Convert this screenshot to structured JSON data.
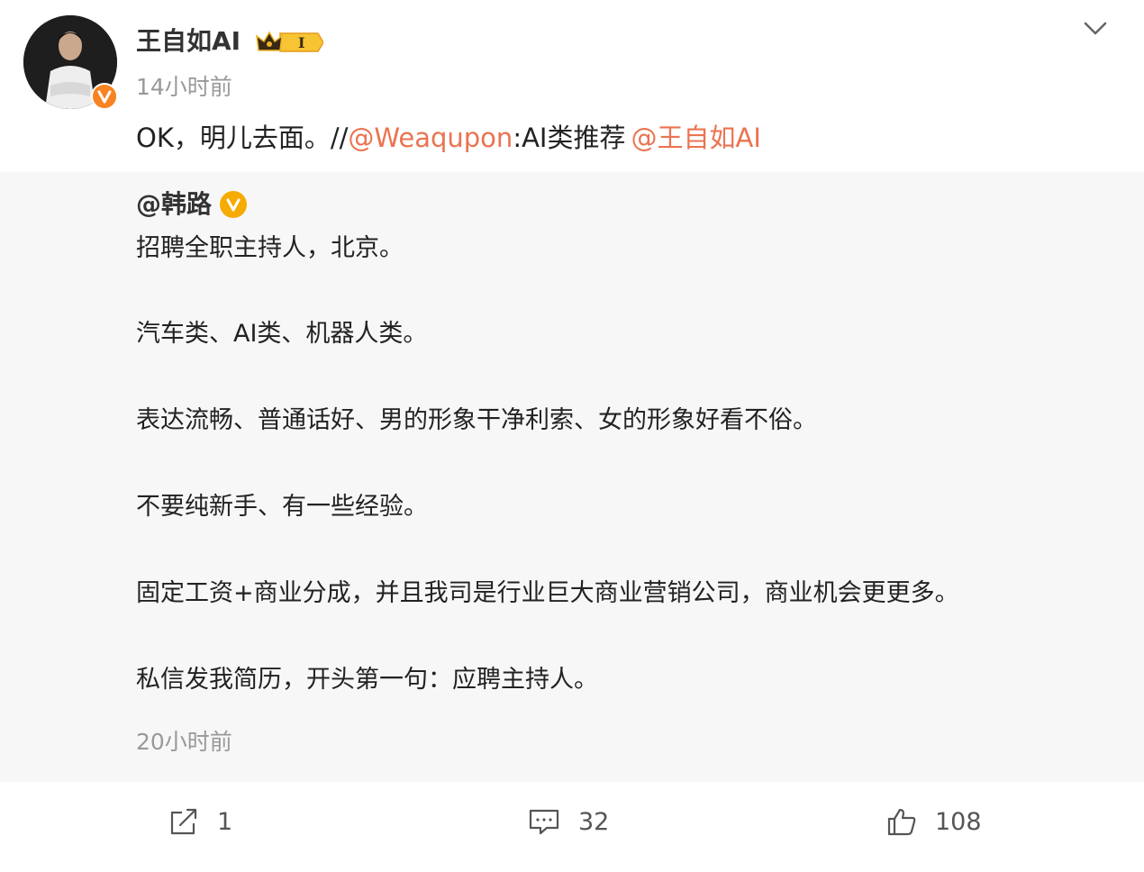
{
  "post": {
    "author": "王自如AI",
    "time": "14小时前",
    "text_prefix": "OK，明儿去面。//",
    "mention_1": "@Weaqupon",
    "text_middle": ":AI类推荐",
    "mention_2": "@王自如AI",
    "vip_level": "I"
  },
  "repost": {
    "author": "@韩路",
    "lines": [
      "招聘全职主持人，北京。",
      "汽车类、AI类、机器人类。",
      "表达流畅、普通话好、男的形象干净利索、女的形象好看不俗。",
      "不要纯新手、有一些经验。",
      "固定工资+商业分成，并且我司是行业巨大商业营销公司，商业机会更更多。",
      "私信发我简历，开头第一句：应聘主持人。"
    ],
    "time": "20小时前"
  },
  "actions": {
    "repost_count": "1",
    "comment_count": "32",
    "like_count": "108"
  },
  "icons": {
    "chevron": "chevron-down-icon",
    "share": "share-icon",
    "comment": "comment-icon",
    "like": "thumbs-up-icon",
    "verified": "verified-v-icon",
    "vip": "crown-icon"
  },
  "colors": {
    "mention": "#eb7350",
    "verified_orange": "#f78321",
    "verified_gold": "#f6ab00",
    "muted": "#999999",
    "repost_bg": "#f7f7f7"
  }
}
